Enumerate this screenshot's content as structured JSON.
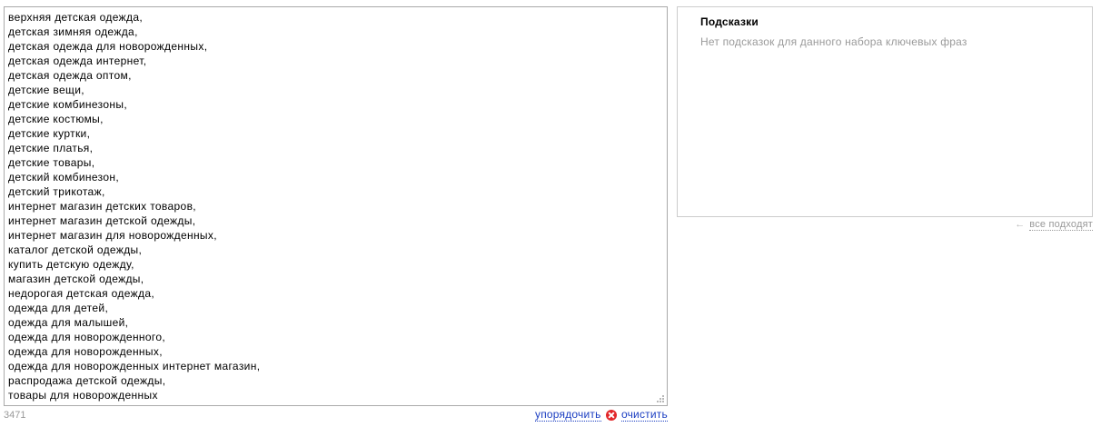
{
  "keywords": {
    "lines": [
      "верхняя детская одежда,",
      "детская зимняя одежда,",
      "детская одежда для новорожденных,",
      "детская одежда интернет,",
      "детская одежда оптом,",
      "детские вещи,",
      "детские комбинезоны,",
      "детские костюмы,",
      "детские куртки,",
      "детские платья,",
      "детские товары,",
      "детский комбинезон,",
      "детский трикотаж,",
      "интернет магазин детских товаров,",
      "интернет магазин детской одежды,",
      "интернет магазин для новорожденных,",
      "каталог детской одежды,",
      "купить детскую одежду,",
      "магазин детской одежды,",
      "недорогая детская одежда,",
      "одежда для детей,",
      "одежда для малышей,",
      "одежда для новорожденного,",
      "одежда для новорожденных,",
      "одежда для новорожденных интернет магазин,",
      "распродажа детской одежды,",
      "товары для новорожденных"
    ],
    "char_count": "3471",
    "sort_label": "упорядочить",
    "clear_label": "очистить"
  },
  "hints": {
    "title": "Подсказки",
    "empty_message": "Нет подсказок для данного набора ключевых фраз",
    "all_fit_label": "все подходят"
  },
  "colors": {
    "link": "#1a3dc1",
    "clear_icon": "#e2272a",
    "muted_text": "#999999"
  },
  "icons": {
    "clear": "clear-icon",
    "all_fit_arrow": "arrow-left-icon",
    "resize": "resize-grip-icon"
  }
}
